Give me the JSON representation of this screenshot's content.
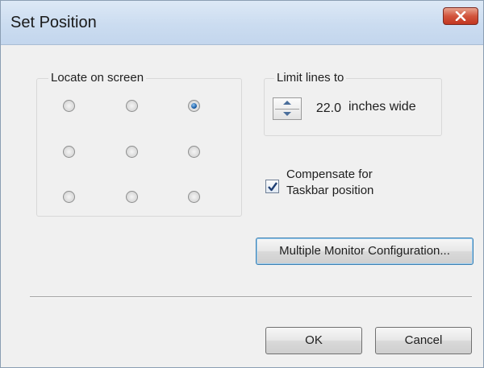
{
  "window": {
    "title": "Set Position"
  },
  "locate": {
    "label": "Locate on screen",
    "radios": [
      {
        "checked": false
      },
      {
        "checked": false
      },
      {
        "checked": true
      },
      {
        "checked": false
      },
      {
        "checked": false
      },
      {
        "checked": false
      },
      {
        "checked": false
      },
      {
        "checked": false
      },
      {
        "checked": false
      }
    ]
  },
  "limit": {
    "label": "Limit lines to",
    "value": "22.0",
    "suffix": "inches wide"
  },
  "compensate": {
    "checked": true,
    "line1": "Compensate for",
    "line2": "Taskbar position"
  },
  "buttons": {
    "multi_monitor": "Multiple Monitor Configuration...",
    "ok": "OK",
    "cancel": "Cancel"
  }
}
